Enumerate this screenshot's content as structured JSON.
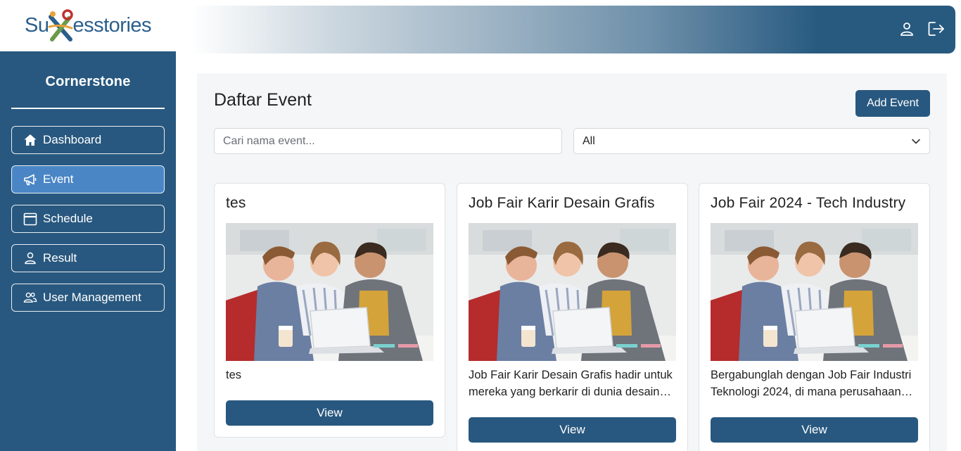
{
  "brand": {
    "logo_prefix": "Su",
    "logo_suffix": "esstories",
    "colors": {
      "primary": "#28587f",
      "active": "#4a86c5",
      "logo_text": "#2b5f8c"
    }
  },
  "sidebar": {
    "title": "Cornerstone",
    "items": [
      {
        "label": "Dashboard",
        "icon": "home-icon",
        "active": false
      },
      {
        "label": "Event",
        "icon": "megaphone-icon",
        "active": true
      },
      {
        "label": "Schedule",
        "icon": "calendar-icon",
        "active": false
      },
      {
        "label": "Result",
        "icon": "user-icon",
        "active": false
      },
      {
        "label": "User Management",
        "icon": "users-icon",
        "active": false
      }
    ]
  },
  "header": {
    "icons": [
      "profile-icon",
      "logout-icon"
    ]
  },
  "main": {
    "title": "Daftar Event",
    "add_button": "Add Event",
    "search_placeholder": "Cari nama event...",
    "search_value": "",
    "filter_value": "All",
    "cards": [
      {
        "title": "tes",
        "description": "tes",
        "button": "View"
      },
      {
        "title": "Job Fair Karir Desain Grafis",
        "description": "Job Fair Karir Desain Grafis hadir untuk mereka yang berkarir di dunia desain grafis",
        "button": "View"
      },
      {
        "title": "Job Fair 2024 - Tech Industry",
        "description": "Bergabunglah dengan Job Fair Industri Teknologi 2024, di mana perusahaan teknologi terkemuka",
        "button": "View"
      }
    ]
  }
}
